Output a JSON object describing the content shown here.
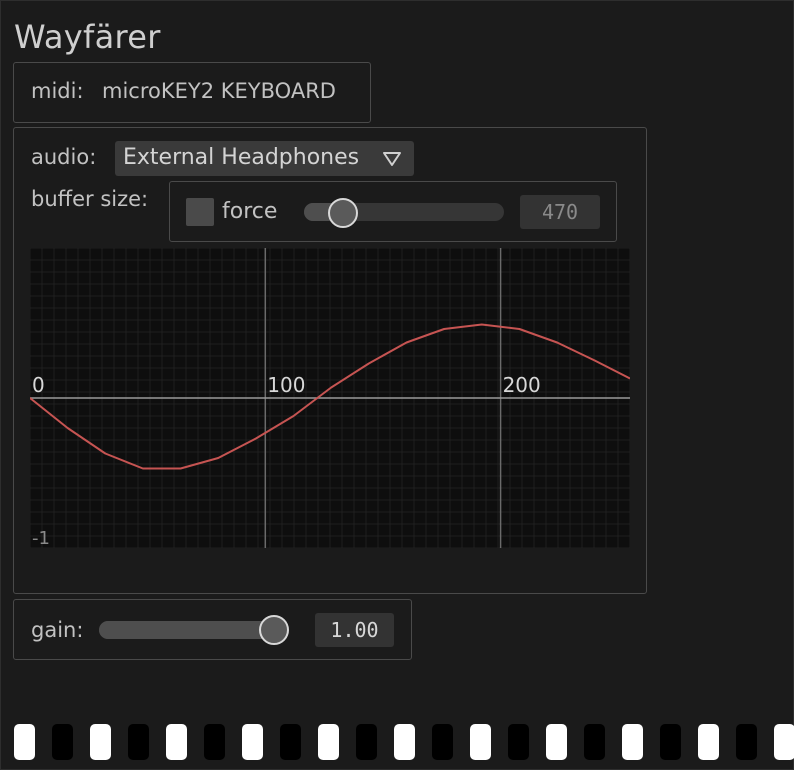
{
  "app": {
    "title": "Wayfärer"
  },
  "midi": {
    "label": "midi:",
    "device": "microKEY2 KEYBOARD"
  },
  "audio": {
    "label": "audio:",
    "device": "External Headphones",
    "dropdown_icon": "triangle-down-icon"
  },
  "buffer": {
    "label": "buffer size:",
    "force_label": "force",
    "force_checked": false,
    "value_text": "470",
    "slider_fraction": 0.14
  },
  "chart_data": {
    "type": "line",
    "title": "",
    "xlabel": "",
    "ylabel": "",
    "xlim": [
      0,
      255
    ],
    "ylim": [
      -1,
      1
    ],
    "grid": true,
    "tick_labels": [
      "0",
      "100",
      "200"
    ],
    "y_min_label": "-1",
    "series": [
      {
        "color": "#c65452",
        "x": [
          0,
          16,
          32,
          48,
          64,
          80,
          96,
          112,
          128,
          144,
          160,
          176,
          192,
          208,
          224,
          240,
          255
        ],
        "y": [
          0.0,
          -0.2,
          -0.37,
          -0.47,
          -0.47,
          -0.4,
          -0.27,
          -0.12,
          0.07,
          0.23,
          0.37,
          0.46,
          0.49,
          0.46,
          0.37,
          0.25,
          0.13
        ]
      }
    ]
  },
  "gain": {
    "label": "gain:",
    "value_text": "1.00",
    "slider_fraction": 1.0
  },
  "keyboard": {
    "key_colors": [
      "white",
      "black",
      "white",
      "black",
      "white",
      "black",
      "white",
      "black",
      "white",
      "black",
      "white",
      "black",
      "white",
      "black",
      "white",
      "black",
      "white",
      "black",
      "white",
      "black",
      "white"
    ]
  },
  "colors": {
    "background": "#1b1b1b",
    "curve": "#c65452",
    "panel_border": "#4a4a4a"
  }
}
